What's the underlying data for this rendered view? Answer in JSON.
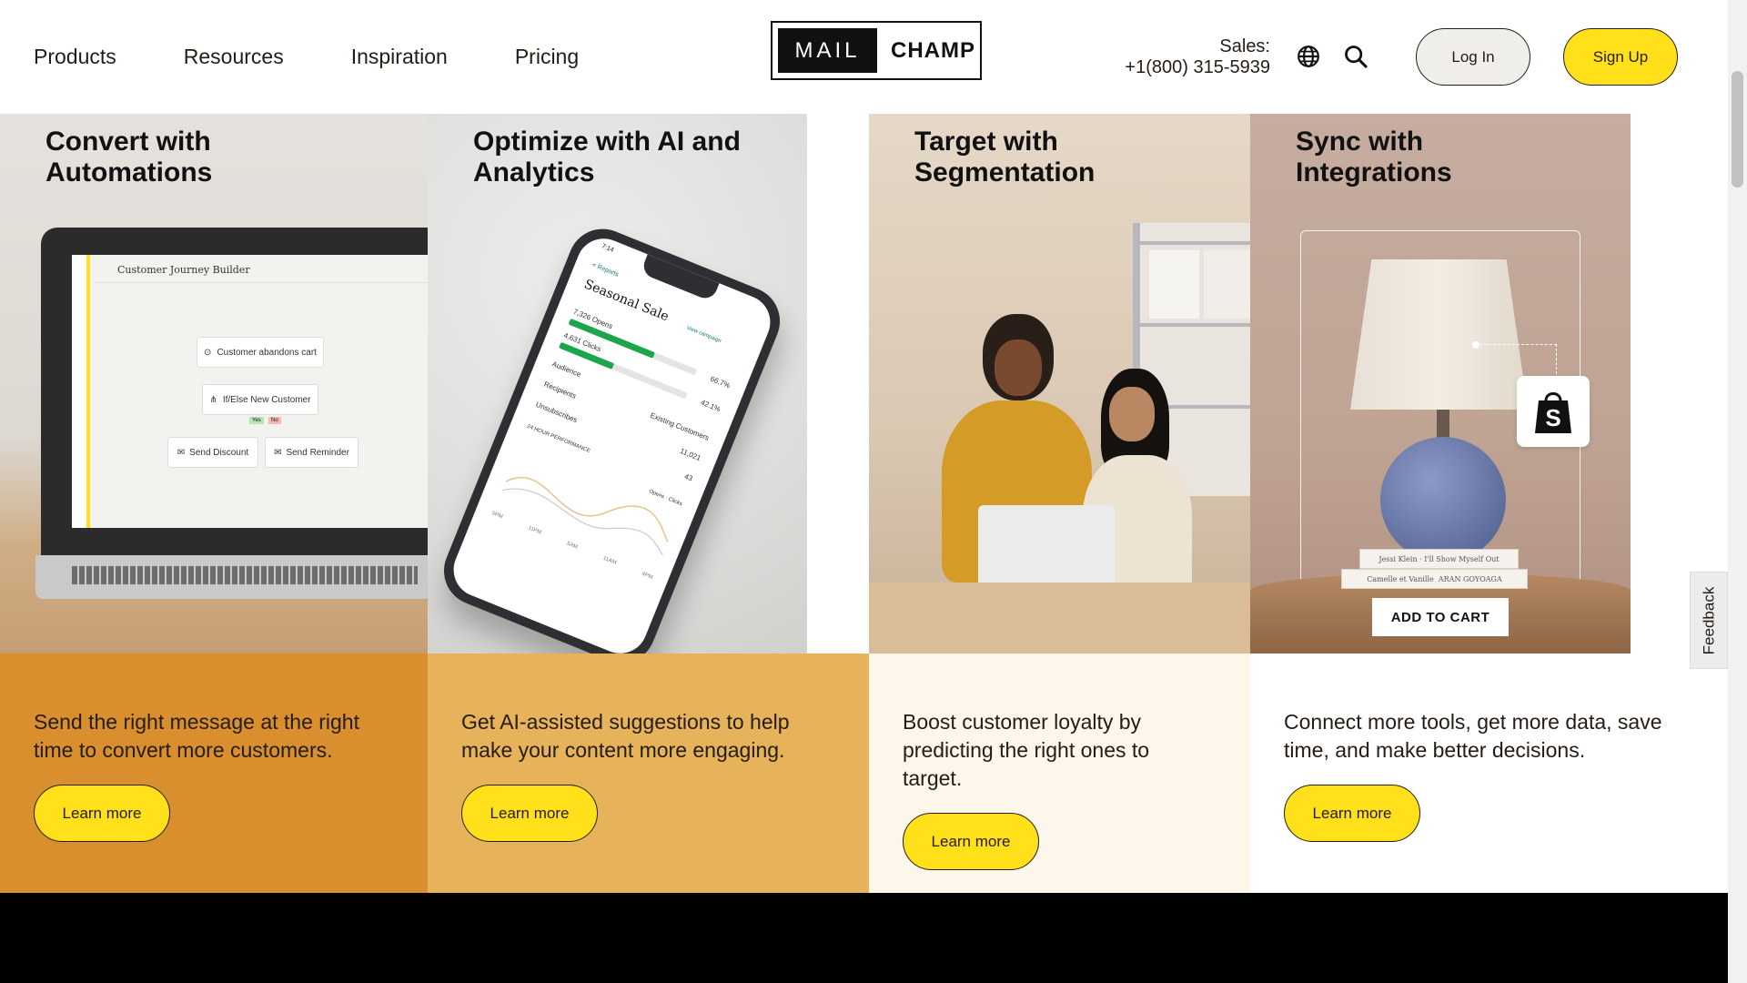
{
  "header": {
    "nav": [
      "Products",
      "Resources",
      "Inspiration",
      "Pricing"
    ],
    "logo": {
      "left": "MAIL",
      "right": "CHAMP"
    },
    "sales_label": "Sales:",
    "sales_phone": "+1(800) 315-5939",
    "login_label": "Log In",
    "signup_label": "Sign Up"
  },
  "cards": [
    {
      "title_line1": "Convert with",
      "title_line2": "Automations",
      "description": "Send the right message at the right time to convert more customers.",
      "button": "Learn more",
      "mock": {
        "screen_title": "Customer Journey Builder",
        "step1": "Customer abandons cart",
        "step2": "If/Else New Customer",
        "yes": "Yes",
        "no": "No",
        "step3": "Send Discount",
        "step4": "Send Reminder"
      }
    },
    {
      "title_line1": "Optimize with AI and",
      "title_line2": "Analytics",
      "description": "Get AI-assisted suggestions to help make your content more engaging.",
      "button": "Learn more",
      "mock": {
        "time": "7:14",
        "back": "< Reports",
        "view": "View campaign",
        "title": "Seasonal Sale",
        "opens_label": "7,326 Opens",
        "opens_pct": "66.7%",
        "opens_value": 0.667,
        "clicks_label": "4,631 Clicks",
        "clicks_pct": "42.1%",
        "clicks_value": 0.421,
        "audience_label": "Audience",
        "audience_value": "Existing Customers",
        "recipients_label": "Recipients",
        "recipients_value": "11,021",
        "unsub_label": "Unsubscribes",
        "unsub_value": "43",
        "perf_label": "24 HOUR PERFORMANCE",
        "legend_opens": "Opens",
        "legend_clicks": "Clicks",
        "times": [
          "5PM",
          "11PM",
          "5AM",
          "11AM",
          "4PM"
        ]
      }
    },
    {
      "title_line1": "Target with",
      "title_line2": "Segmentation",
      "description": "Boost customer loyalty by predicting the right ones to target.",
      "button": "Learn more"
    },
    {
      "title_line1": "Sync with",
      "title_line2": "Integrations",
      "description": "Connect more tools, get more data, save time, and make better decisions.",
      "button": "Learn more",
      "mock": {
        "add_to_cart": "ADD TO CART",
        "book1": "Jessi Klein · I'll Show Myself Out",
        "book2": "Camelle et Vanille",
        "book3": "ARAN GOYOAGA"
      }
    }
  ],
  "feedback_label": "Feedback",
  "colors": {
    "brand_yellow": "#ffe01b",
    "card1_bottom": "#d98f2d",
    "card2_bottom": "#e6b25a",
    "card3_bottom": "#fdf6ea"
  }
}
